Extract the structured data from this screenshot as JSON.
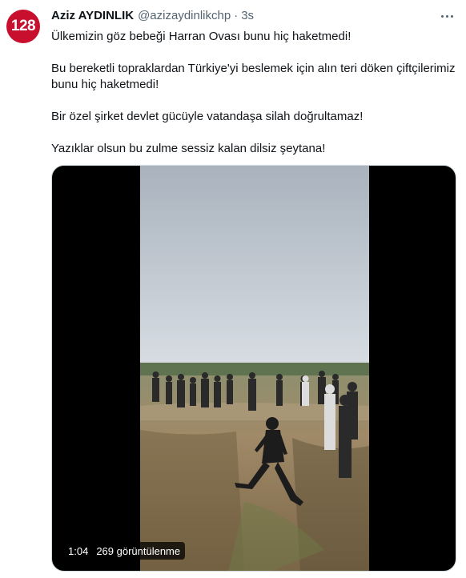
{
  "author": {
    "avatar_text": "128",
    "avatar_color": "#c8102e",
    "name": "Aziz AYDINLIK",
    "handle": "@azizaydinlikchp",
    "separator": "·",
    "time": "3s"
  },
  "actions": {
    "more_icon": "more-horizontal-icon"
  },
  "tweet": {
    "paragraphs": [
      "Ülkemizin göz bebeği Harran Ovası bunu hiç haketmedi!",
      "Bu bereketli topraklardan Türkiye'yi beslemek için alın teri döken çiftçilerimiz bunu hiç haketmedi!",
      "Bir özel şirket devlet gücüyle vatandaşa silah doğrultamaz!",
      "Yazıklar olsun bu zulme sessiz kalan dilsiz şeytana!"
    ]
  },
  "media": {
    "duration": "1:04",
    "views": "269 görüntülenme"
  }
}
